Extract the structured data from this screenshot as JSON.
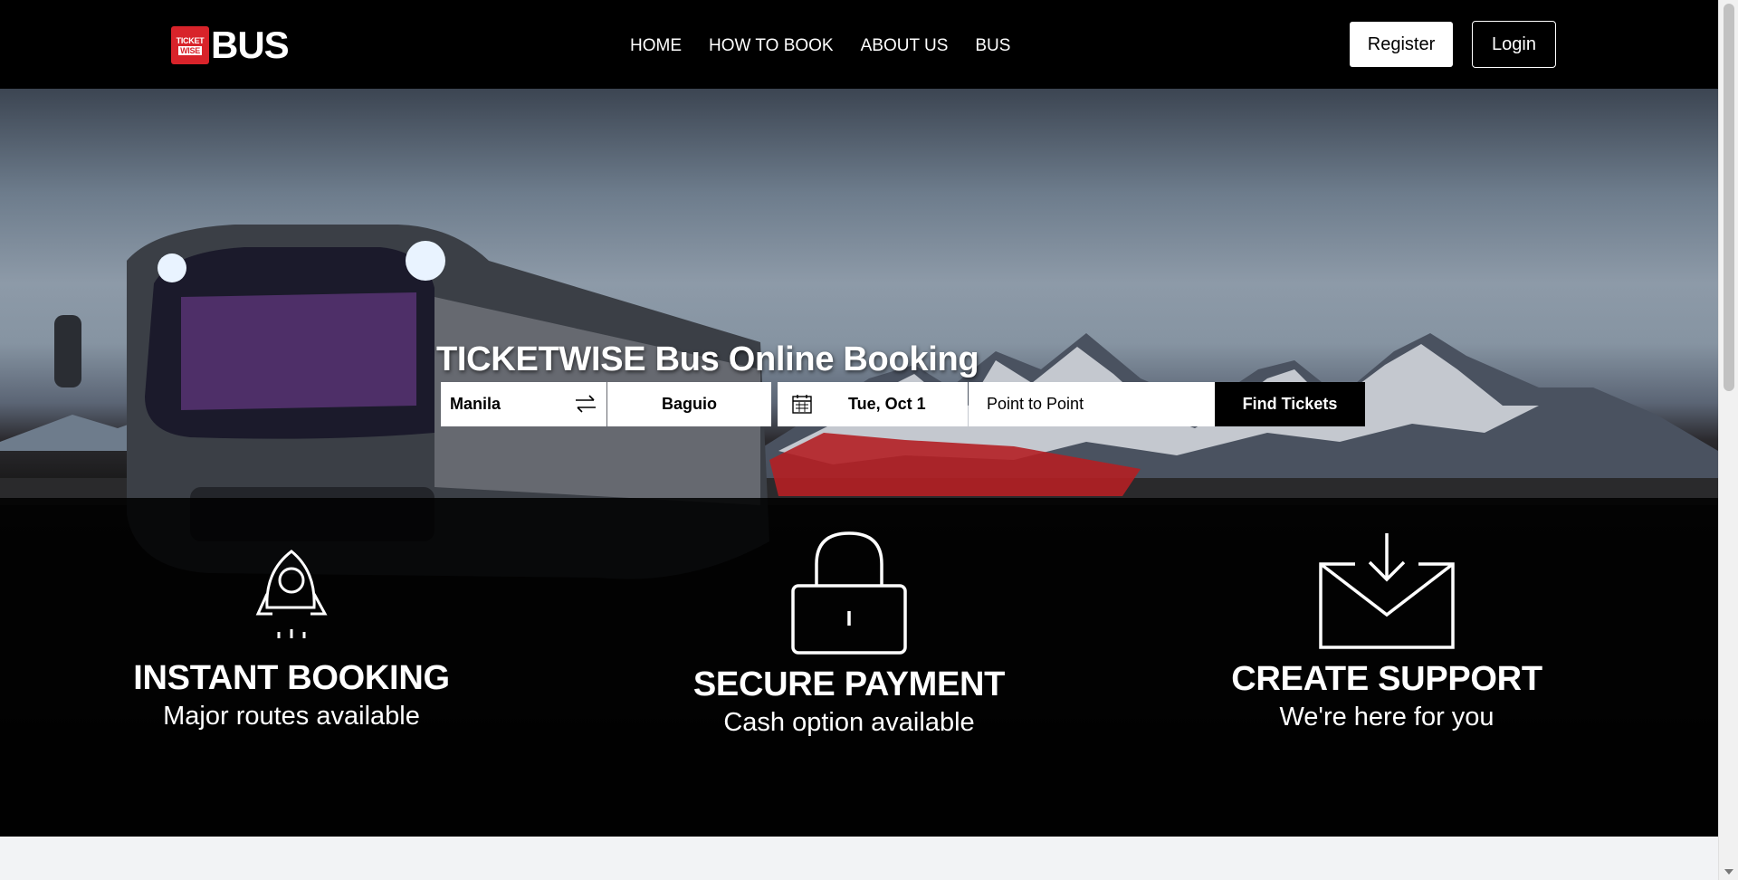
{
  "header": {
    "logo_text": "BUS",
    "logo_badge_top": "TICKET",
    "logo_badge_bottom": "WISE",
    "nav": [
      "HOME",
      "HOW TO BOOK",
      "ABOUT US",
      "BUS"
    ],
    "register_label": "Register",
    "login_label": "Login"
  },
  "hero": {
    "title": "TICKETWISE Bus Online Booking",
    "search": {
      "from": "Manila",
      "to": "Baguio",
      "date": "Tue, Oct 1",
      "trip_type": "Point to Point",
      "find_label": "Find Tickets"
    }
  },
  "features": [
    {
      "title": "INSTANT BOOKING",
      "subtitle": "Major routes available",
      "icon": "rocket-icon"
    },
    {
      "title": "SECURE PAYMENT",
      "subtitle": "Cash option available",
      "icon": "lock-icon"
    },
    {
      "title": "CREATE SUPPORT",
      "subtitle": "We're here for you",
      "icon": "mail-download-icon"
    }
  ],
  "colors": {
    "header_bg": "#000000",
    "brand_red": "#d8232a",
    "page_bg": "#f2f3f5"
  }
}
